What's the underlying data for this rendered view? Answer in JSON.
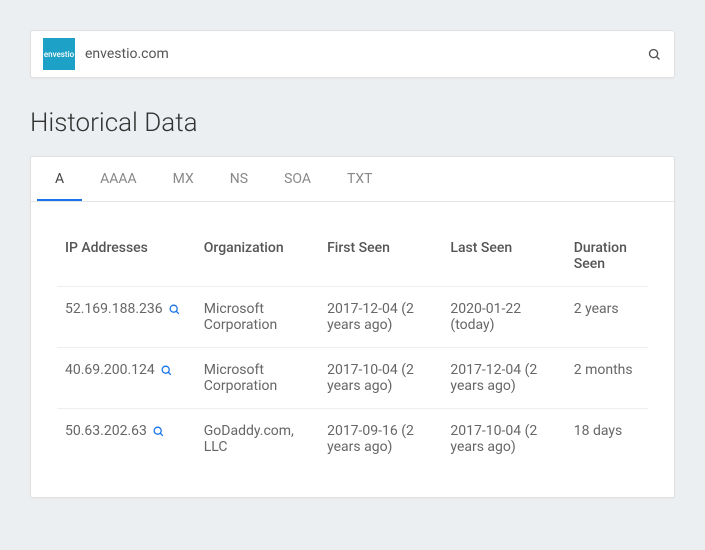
{
  "search": {
    "logo_text": "envestio",
    "value": "envestio.com"
  },
  "page_title": "Historical Data",
  "tabs": [
    {
      "label": "A",
      "active": true
    },
    {
      "label": "AAAA",
      "active": false
    },
    {
      "label": "MX",
      "active": false
    },
    {
      "label": "NS",
      "active": false
    },
    {
      "label": "SOA",
      "active": false
    },
    {
      "label": "TXT",
      "active": false
    }
  ],
  "columns": {
    "ip": "IP Addresses",
    "org": "Organization",
    "first": "First Seen",
    "last": "Last Seen",
    "dur": "Duration Seen"
  },
  "rows": [
    {
      "ip": "52.169.188.236",
      "org": "Microsoft Corporation",
      "first": "2017-12-04 (2 years ago)",
      "last": "2020-01-22 (today)",
      "dur": "2 years"
    },
    {
      "ip": "40.69.200.124",
      "org": "Microsoft Corporation",
      "first": "2017-10-04 (2 years ago)",
      "last": "2017-12-04 (2 years ago)",
      "dur": "2 months"
    },
    {
      "ip": "50.63.202.63",
      "org": "GoDaddy.com, LLC",
      "first": "2017-09-16 (2 years ago)",
      "last": "2017-10-04 (2 years ago)",
      "dur": "18 days"
    }
  ]
}
